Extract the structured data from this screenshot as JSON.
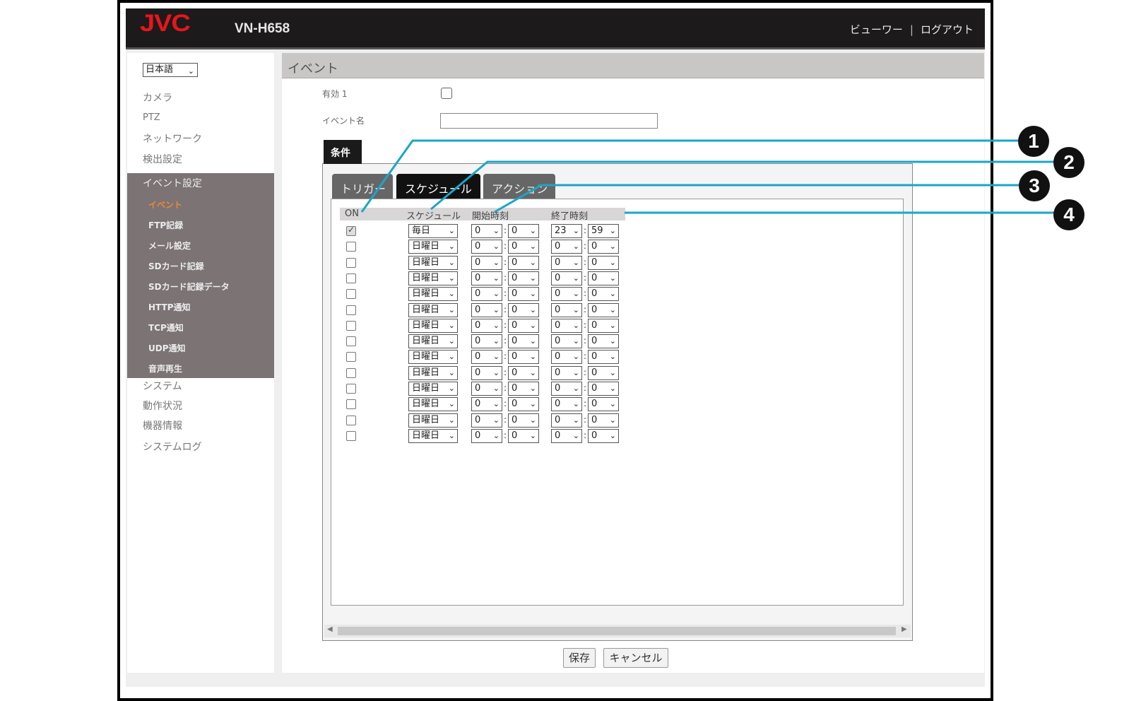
{
  "header": {
    "logo": "JVC",
    "model": "VN-H658",
    "viewer_link": "ビューワー",
    "separator": "|",
    "logout_link": "ログアウト"
  },
  "sidebar": {
    "language": "日本語",
    "items_top": [
      "カメラ",
      "PTZ",
      "ネットワーク",
      "検出設定"
    ],
    "group_label": "イベント設定",
    "sub_items": [
      "イベント",
      "FTP記録",
      "メール設定",
      "SDカード記録",
      "SDカード記録データ",
      "HTTP通知",
      "TCP通知",
      "UDP通知",
      "音声再生"
    ],
    "active_sub_item": "イベント",
    "items_bottom": [
      "システム",
      "動作状況",
      "機器情報",
      "システムログ"
    ]
  },
  "main": {
    "title": "イベント",
    "enable_label": "有効 1",
    "event_name_label": "イベント名",
    "event_name_value": "",
    "tab_condition": "条件",
    "subtabs": [
      "トリガー",
      "スケジュール",
      "アクション"
    ],
    "active_subtab": "スケジュール",
    "table": {
      "headers": [
        "ON",
        "スケジュール",
        "開始時刻",
        "終了時刻"
      ],
      "time_separator": ":",
      "rows": [
        {
          "on": true,
          "schedule": "毎日",
          "start_h": "0",
          "start_m": "0",
          "end_h": "23",
          "end_m": "59"
        },
        {
          "on": false,
          "schedule": "日曜日",
          "start_h": "0",
          "start_m": "0",
          "end_h": "0",
          "end_m": "0"
        },
        {
          "on": false,
          "schedule": "日曜日",
          "start_h": "0",
          "start_m": "0",
          "end_h": "0",
          "end_m": "0"
        },
        {
          "on": false,
          "schedule": "日曜日",
          "start_h": "0",
          "start_m": "0",
          "end_h": "0",
          "end_m": "0"
        },
        {
          "on": false,
          "schedule": "日曜日",
          "start_h": "0",
          "start_m": "0",
          "end_h": "0",
          "end_m": "0"
        },
        {
          "on": false,
          "schedule": "日曜日",
          "start_h": "0",
          "start_m": "0",
          "end_h": "0",
          "end_m": "0"
        },
        {
          "on": false,
          "schedule": "日曜日",
          "start_h": "0",
          "start_m": "0",
          "end_h": "0",
          "end_m": "0"
        },
        {
          "on": false,
          "schedule": "日曜日",
          "start_h": "0",
          "start_m": "0",
          "end_h": "0",
          "end_m": "0"
        },
        {
          "on": false,
          "schedule": "日曜日",
          "start_h": "0",
          "start_m": "0",
          "end_h": "0",
          "end_m": "0"
        },
        {
          "on": false,
          "schedule": "日曜日",
          "start_h": "0",
          "start_m": "0",
          "end_h": "0",
          "end_m": "0"
        },
        {
          "on": false,
          "schedule": "日曜日",
          "start_h": "0",
          "start_m": "0",
          "end_h": "0",
          "end_m": "0"
        },
        {
          "on": false,
          "schedule": "日曜日",
          "start_h": "0",
          "start_m": "0",
          "end_h": "0",
          "end_m": "0"
        },
        {
          "on": false,
          "schedule": "日曜日",
          "start_h": "0",
          "start_m": "0",
          "end_h": "0",
          "end_m": "0"
        },
        {
          "on": false,
          "schedule": "日曜日",
          "start_h": "0",
          "start_m": "0",
          "end_h": "0",
          "end_m": "0"
        }
      ]
    },
    "save_button": "保存",
    "cancel_button": "キャンセル"
  },
  "callouts": [
    "1",
    "2",
    "3",
    "4"
  ],
  "colors": {
    "header_bg": "#1d1a1b",
    "logo_red": "#e6161b",
    "active_orange": "#f08a2c",
    "sidebar_group_bg": "#7c7375",
    "callout_line": "#1aa6c8"
  }
}
